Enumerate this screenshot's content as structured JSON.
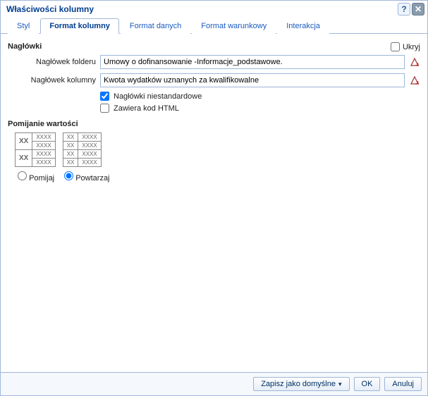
{
  "dialog": {
    "title": "Właściwości kolumny"
  },
  "tabs": {
    "styl": "Styl",
    "format_kolumny": "Format kolumny",
    "format_danych": "Format danych",
    "format_warunkowy": "Format warunkowy",
    "interakcja": "Interakcja"
  },
  "headers": {
    "section_title": "Nagłówki",
    "hide_label": "Ukryj",
    "hide_checked": false,
    "folder_label": "Nagłówek folderu",
    "folder_value": "Umowy o dofinansowanie -Informacje_podstawowe.",
    "column_label": "Nagłówek kolumny",
    "column_value": "Kwota wydatków uznanych za kwalifikowalne",
    "custom_label": "Nagłówki niestandardowe",
    "custom_checked": true,
    "html_label": "Zawiera kod HTML",
    "html_checked": false
  },
  "suppress": {
    "section_title": "Pomijanie wartości",
    "skip_label": "Pomijaj",
    "repeat_label": "Powtarzaj",
    "selected": "repeat",
    "grid_cells": {
      "xx": "XX",
      "xxxx": "XXXX"
    }
  },
  "buttons": {
    "save_default": "Zapisz jako domyślne",
    "ok": "OK",
    "cancel": "Anuluj"
  }
}
